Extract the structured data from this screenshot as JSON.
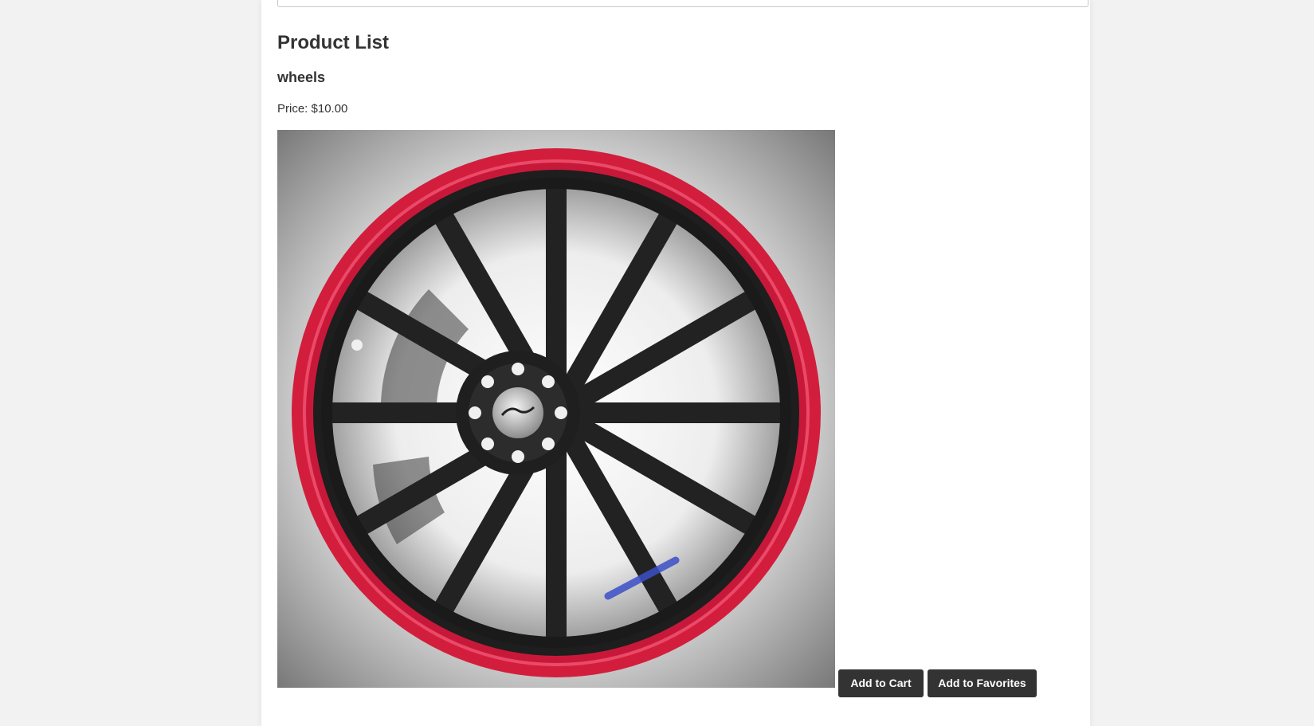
{
  "product_list": {
    "title": "Product List",
    "products": [
      {
        "name": "wheels",
        "price_label": "Price: $10.00",
        "image_alt": "",
        "add_to_cart_label": "Add to Cart",
        "add_to_favorites_label": "Add to Favorites"
      }
    ]
  },
  "colors": {
    "button_bg": "#333333",
    "button_text": "#ffffff",
    "page_bg": "#f2f2f2",
    "card_bg": "#ffffff",
    "rim_accent": "#d21e3c"
  }
}
